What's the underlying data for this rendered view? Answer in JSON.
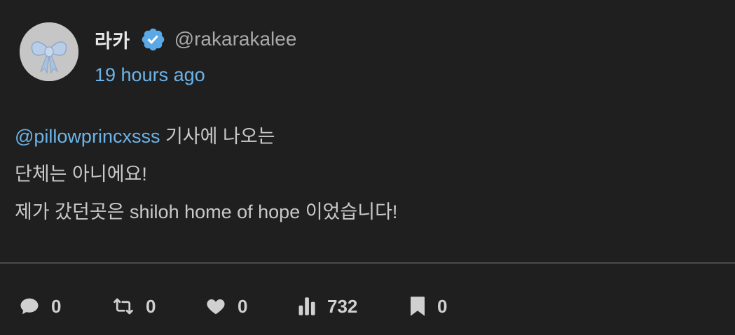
{
  "author": {
    "display_name": "라카",
    "handle": "@rakarakalee",
    "timestamp": "19 hours ago",
    "verified": true
  },
  "post": {
    "mention": "@pillowprincxsss",
    "line1_rest": " 기사에 나오는",
    "line2": "단체는 아니에요!",
    "line3": "제가 갔던곳은 shiloh home of hope 이었습니다!"
  },
  "stats": {
    "replies": "0",
    "reposts": "0",
    "likes": "0",
    "views": "732",
    "bookmarks": "0"
  },
  "icons": {
    "reply": "comment-icon",
    "repost": "repost-icon",
    "like": "heart-icon",
    "views": "views-chart-icon",
    "bookmark": "bookmark-icon",
    "verified": "verified-badge-icon",
    "avatar": "ribbon-bow-avatar"
  },
  "colors": {
    "background": "#1f1f1f",
    "accent": "#6cb4e8",
    "verified": "#1d9bf0",
    "text": "#c9c9c9"
  }
}
